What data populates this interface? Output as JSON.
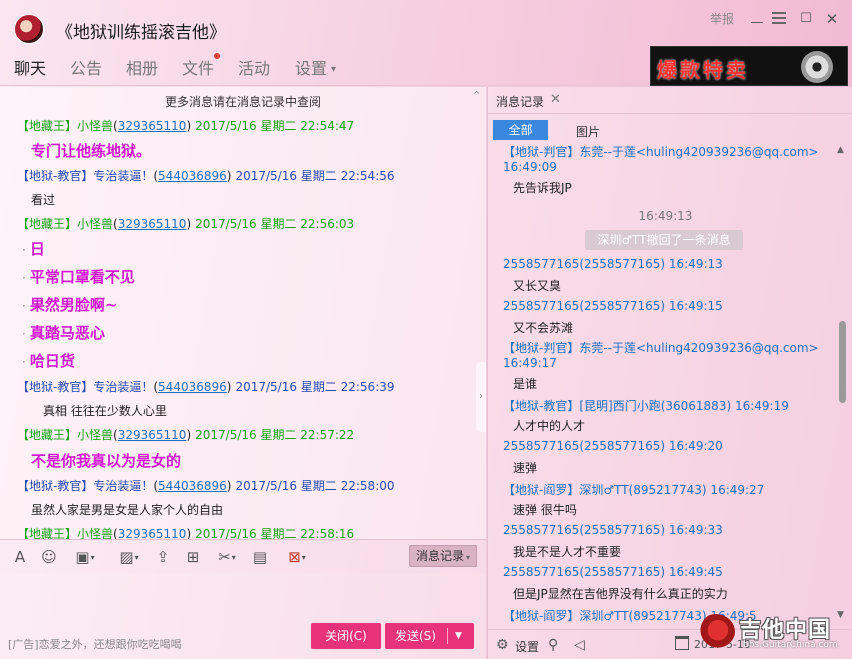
{
  "window": {
    "title": "《地狱训练摇滚吉他》",
    "report_label": "举报"
  },
  "tabs": [
    {
      "label": "聊天",
      "active": true
    },
    {
      "label": "公告"
    },
    {
      "label": "相册"
    },
    {
      "label": "文件",
      "badge": true
    },
    {
      "label": "活动"
    },
    {
      "label": "设置",
      "has_caret": true
    }
  ],
  "ad_banner": {
    "text": "爆款特卖"
  },
  "chat": {
    "notice": "更多消息请在消息记录中查阅",
    "lines": [
      {
        "kind": "header",
        "color": "green",
        "tag": "【地藏王】",
        "name": "小怪兽",
        "qq_pre": "(",
        "qq": "329365110",
        "qq_post": ")",
        "time": "2017/5/16 星期二 22:54:47"
      },
      {
        "kind": "msg",
        "style": "pink",
        "text": "专门让他练地狱。"
      },
      {
        "kind": "header",
        "color": "blue",
        "tag": "【地狱-教官】",
        "name": "专治装逼！",
        "qq_pre": "(",
        "qq": "544036896",
        "qq_post": ")",
        "time": "2017/5/16 星期二 22:54:56"
      },
      {
        "kind": "msg",
        "text": "看过"
      },
      {
        "kind": "header",
        "color": "green",
        "tag": "【地藏王】",
        "name": "小怪兽",
        "qq_pre": "(",
        "qq": "329365110",
        "qq_post": ")",
        "time": "2017/5/16 星期二 22:56:03"
      },
      {
        "kind": "bullet",
        "text": "日"
      },
      {
        "kind": "bullet",
        "text": "平常口罩看不见"
      },
      {
        "kind": "bullet",
        "text": "果然男脸啊~"
      },
      {
        "kind": "bullet",
        "text": "真踏马恶心"
      },
      {
        "kind": "bullet",
        "text": "哈日货"
      },
      {
        "kind": "header",
        "color": "blue",
        "tag": "【地狱-教官】",
        "name": "专治装逼！",
        "qq_pre": "(",
        "qq": "544036896",
        "qq_post": ")",
        "time": "2017/5/16 星期二 22:56:39"
      },
      {
        "kind": "msg",
        "indent": true,
        "text": "真相  往往在少数人心里"
      },
      {
        "kind": "header",
        "color": "green",
        "tag": "【地藏王】",
        "name": "小怪兽",
        "qq_pre": "(",
        "qq": "329365110",
        "qq_post": ")",
        "time": "2017/5/16 星期二 22:57:22"
      },
      {
        "kind": "msg",
        "style": "pink",
        "text": "不是你我真以为是女的"
      },
      {
        "kind": "header",
        "color": "blue",
        "tag": "【地狱-教官】",
        "name": "专治装逼！",
        "qq_pre": "(",
        "qq": "544036896",
        "qq_post": ")",
        "time": "2017/5/16 星期二 22:58:00"
      },
      {
        "kind": "msg",
        "text": "虽然人家是男是女是人家个人的自由"
      },
      {
        "kind": "header",
        "color": "green",
        "tag": "【地藏王】",
        "name": "小怪兽",
        "qq_pre": "(",
        "qq": "329365110",
        "qq_post": ")",
        "time": "2017/5/16 星期二 22:58:16"
      }
    ]
  },
  "toolbar": {
    "icons": [
      "font-icon",
      "emoji-icon",
      "gift-icon",
      "image-icon",
      "upload-icon",
      "present-icon",
      "scissors-icon",
      "history-file-icon",
      "remote-icon"
    ],
    "history_label": "消息记录"
  },
  "input": {
    "ad_text": "[广告]恋爱之外，还想跟你吃吃喝喝",
    "close_label": "关闭(C)",
    "send_label": "发送(S)"
  },
  "history": {
    "tab_label": "消息记录",
    "filter_all": "全部",
    "filter_pic": "图片",
    "lines": [
      {
        "kind": "h",
        "wrap": true,
        "text": "【地狱-判官】东莞--于莲<huling420939236@qq.com> 16:49:09"
      },
      {
        "kind": "t",
        "text": "先告诉我JP"
      },
      {
        "kind": "time",
        "text": "16:49:13"
      },
      {
        "kind": "recall",
        "text": "深圳♂TT撤回了一条消息"
      },
      {
        "kind": "h",
        "text": "2558577165(2558577165) 16:49:13"
      },
      {
        "kind": "t",
        "text": "又长又臭"
      },
      {
        "kind": "h",
        "text": "2558577165(2558577165) 16:49:15"
      },
      {
        "kind": "t",
        "text": "又不会苏滩"
      },
      {
        "kind": "h",
        "wrap": true,
        "text": "【地狱-判官】东莞--于莲<huling420939236@qq.com> 16:49:17"
      },
      {
        "kind": "t",
        "text": "是谁"
      },
      {
        "kind": "h",
        "text": "【地狱-教官】[昆明]西门小跑(36061883) 16:49:19"
      },
      {
        "kind": "t",
        "text": "人才中的人才"
      },
      {
        "kind": "h",
        "text": "2558577165(2558577165) 16:49:20"
      },
      {
        "kind": "t",
        "text": "速弹"
      },
      {
        "kind": "h",
        "text": "【地狱-阎罗】深圳♂TT(895217743) 16:49:27"
      },
      {
        "kind": "t",
        "text": "速弹 很牛吗"
      },
      {
        "kind": "h",
        "text": "2558577165(2558577165) 16:49:33"
      },
      {
        "kind": "t",
        "text": "我是不是人才不重要"
      },
      {
        "kind": "h",
        "text": "2558577165(2558577165) 16:49:45"
      },
      {
        "kind": "t",
        "text": "但是JP显然在吉他界没有什么真正的实力"
      },
      {
        "kind": "h",
        "text": "【地狱-阎罗】深圳♂TT(895217743) 16:49:5"
      }
    ],
    "bottom_settings": "设置",
    "date_fragment": "2017-5-10"
  },
  "watermark": {
    "text": "吉他中国",
    "url": "bbs.GuitarChina.com"
  }
}
